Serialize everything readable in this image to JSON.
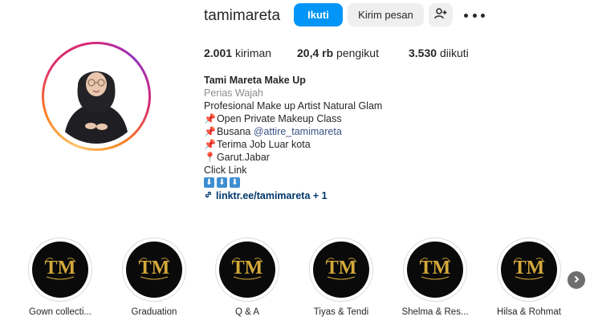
{
  "profile": {
    "username": "tamimareta",
    "follow_label": "Ikuti",
    "message_label": "Kirim pesan"
  },
  "stats": {
    "posts_value": "2.001",
    "posts_label": "kiriman",
    "followers_value": "20,4 rb",
    "followers_label": "pengikut",
    "following_value": "3.530",
    "following_label": "diikuti"
  },
  "bio": {
    "name": "Tami Mareta Make Up",
    "category": "Perias Wajah",
    "line1": "Profesional Make up Artist Natural Glam",
    "line2": "Open Private Makeup Class",
    "line3_prefix": "Busana ",
    "line3_mention": "@attire_tamimareta",
    "line4": "Terima Job Luar kota",
    "line5": "Garut.Jabar",
    "line6": "Click Link",
    "link_text": "linktr.ee/tamimareta + 1"
  },
  "highlights": [
    {
      "label": "Gown collecti..."
    },
    {
      "label": "Graduation"
    },
    {
      "label": "Q & A"
    },
    {
      "label": "Tiyas & Tendi"
    },
    {
      "label": "Shelma & Res..."
    },
    {
      "label": "Hilsa & Rohmat"
    }
  ],
  "colors": {
    "accent_blue": "#0095f6",
    "gold": "#d4a93a",
    "link": "#00376b"
  },
  "icons": [
    "add-person-icon",
    "more-icon",
    "pin-icon",
    "down-arrow-icon",
    "link-icon",
    "chevron-right-icon"
  ]
}
